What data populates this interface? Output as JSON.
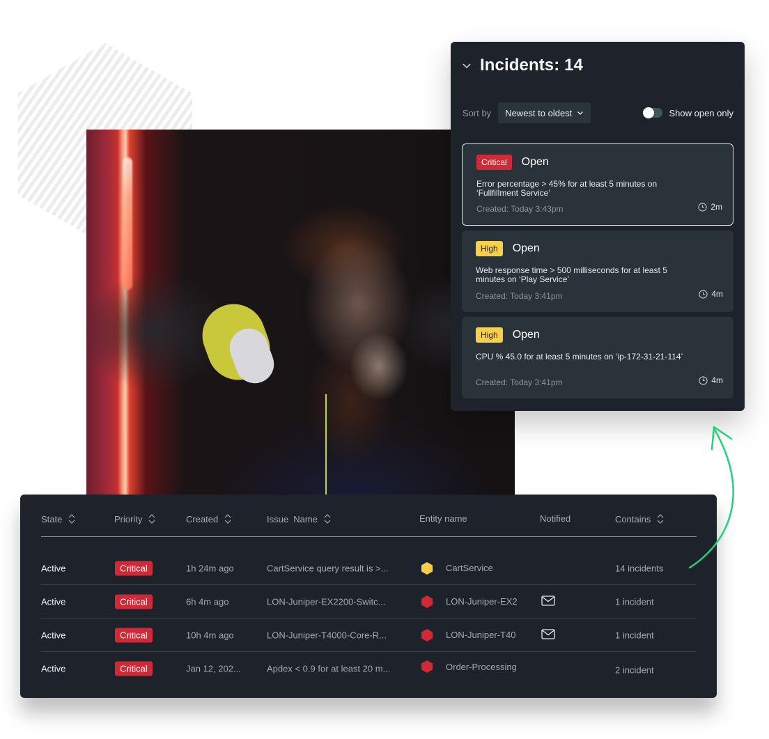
{
  "colors": {
    "panel_bg": "#1e232b",
    "card_bg": "#2a333a",
    "critical": "#cf2a38",
    "high": "#f7cf4b",
    "accent_arrow": "#22d37a"
  },
  "incidents_panel": {
    "title": "Incidents: 14",
    "collapse_icon": "chevron-down-icon",
    "sort_label": "Sort by",
    "sort_value": "Newest to oldest",
    "toggle_label": "Show open only",
    "toggle_on": false,
    "cards": [
      {
        "priority": "Critical",
        "status": "Open",
        "description": "Error percentage > 45% for at least 5 minutes on ‘Fullfillment Service’",
        "created": "Created: Today 3:43pm",
        "age": "2m",
        "selected": true
      },
      {
        "priority": "High",
        "status": "Open",
        "description": "Web response time > 500 milliseconds for at least 5 minutes on ‘Play Service’",
        "created": "Created: Today 3:41pm",
        "age": "4m",
        "selected": false
      },
      {
        "priority": "High",
        "status": "Open",
        "description": "CPU % 45.0 for at least 5 minutes on ‘ip-172-31-21-114’",
        "created": "Created: Today 3:41pm",
        "age": "4m",
        "selected": false
      }
    ]
  },
  "table": {
    "headers": [
      {
        "label": "State",
        "sortable": true
      },
      {
        "label": "Priority",
        "sortable": true
      },
      {
        "label": "Created",
        "sortable": true
      },
      {
        "label": "Issue  Name",
        "sortable": true
      },
      {
        "label": "Entity name",
        "sortable": false
      },
      {
        "label": "Notified",
        "sortable": false
      },
      {
        "label": "Contains",
        "sortable": true
      }
    ],
    "rows": [
      {
        "state": "Active",
        "priority": "Critical",
        "created": "1h 24m ago",
        "issue": "CartService query result is >...",
        "entity": "CartService",
        "entity_color": "#f7cf4b",
        "notified": false,
        "contains": "14 incidents"
      },
      {
        "state": "Active",
        "priority": "Critical",
        "created": "6h 4m ago",
        "issue": "LON-Juniper-EX2200-Switc...",
        "entity": "LON-Juniper-EX2",
        "entity_color": "#cf2a38",
        "notified": true,
        "contains": "1 incident"
      },
      {
        "state": "Active",
        "priority": "Critical",
        "created": "10h 4m ago",
        "issue": "LON-Juniper-T4000-Core-R...",
        "entity": "LON-Juniper-T40",
        "entity_color": "#cf2a38",
        "notified": true,
        "contains": "1 incident"
      },
      {
        "state": "Active",
        "priority": "Critical",
        "created": "Jan 12, 202...",
        "issue": "Apdex < 0.9 for at least 20 m...",
        "entity": "Order-Processing",
        "entity_color": "#cf2a38",
        "notified": false,
        "contains": "2 incident"
      }
    ]
  },
  "photo": {
    "description": "Man with beard wearing headset at a desk in a dim room with red neon light"
  }
}
